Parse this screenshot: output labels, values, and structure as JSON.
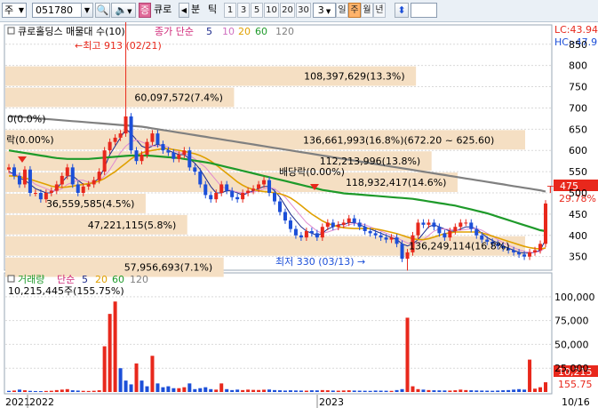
{
  "toolbar": {
    "market": "주",
    "stock_code": "051780",
    "stock_name": "큐로",
    "period_prefix": "분",
    "tick_label": "틱",
    "period_numbers": [
      "1",
      "3",
      "5",
      "10",
      "20",
      "30"
    ],
    "period_custom": "3",
    "period_options": [
      "일",
      "주",
      "월",
      "년"
    ],
    "active_period": "주",
    "badge": "증"
  },
  "colors": {
    "up": "#e8281c",
    "down": "#1c4fd8",
    "ma5": "#1c2a8c",
    "ma10": "#e08bd0",
    "ma20": "#e0a000",
    "ma60": "#1e9a2a",
    "ma120": "#808080",
    "volume_profile": "#f5dfc3"
  },
  "price_panel": {
    "title": "큐로홀딩스 매물대 수(10)",
    "ma_label": "종가 단순",
    "ma_periods": [
      "5",
      "10",
      "20",
      "60",
      "120"
    ],
    "max_annotation": "최고 913 (02/21)",
    "min_annotation": "최저 330 (03/13)",
    "dividend_annotations": [
      "배당락(0.00%)",
      "락(0.00%)"
    ],
    "lc_label": "LC:43.94",
    "hc_label": "HC:-47.9",
    "current_price": "475",
    "pct_label": "29.78%",
    "marker_t": "T",
    "y_ticks": [
      "850",
      "800",
      "750",
      "700",
      "650",
      "600",
      "550",
      "500",
      "450",
      "400",
      "350"
    ]
  },
  "volume_panel": {
    "title": "거래량",
    "ma_label": "단순",
    "ma_periods": [
      "5",
      "20",
      "60",
      "120"
    ],
    "current_volume": "10,215,445주(155.75%)",
    "y_ticks": [
      "100,000",
      "75,000",
      "50,000",
      "25,000"
    ],
    "last_value_label": "10,215",
    "last_pct_label": "155.75"
  },
  "x_axis": {
    "labels": [
      "2021",
      "2022",
      "2023",
      "10/16"
    ]
  },
  "chart_data": [
    {
      "type": "bar",
      "title": "매물대",
      "orientation": "horizontal",
      "price_bands": [
        {
          "low": 800,
          "high": 850,
          "label": "",
          "rel": 0.0
        },
        {
          "low": 750,
          "high": 800,
          "label": "108,397,629(13.3%)",
          "rel": 0.79
        },
        {
          "low": 700,
          "high": 750,
          "label": "60,097,572(7.4%)",
          "rel": 0.44
        },
        {
          "low": 650,
          "high": 700,
          "label": "0(0.0%)",
          "rel": 0.0
        },
        {
          "low": 600,
          "high": 650,
          "label": "136,661,993(16.8%)(672.20 ~ 625.60)",
          "rel": 1.0
        },
        {
          "low": 550,
          "high": 600,
          "label": "112,213,996(13.8%)",
          "rel": 0.82
        },
        {
          "low": 500,
          "high": 550,
          "label": "118,932,417(14.6%)",
          "rel": 0.87
        },
        {
          "low": 450,
          "high": 500,
          "label": "36,559,585(4.5%)",
          "rel": 0.27
        },
        {
          "low": 400,
          "high": 450,
          "label": "47,221,115(5.8%)",
          "rel": 0.35
        },
        {
          "low": 350,
          "high": 400,
          "label": "136,249,114(16.8%)",
          "rel": 1.0
        },
        {
          "low": 300,
          "high": 350,
          "label": "57,956,693(7.1%)",
          "rel": 0.42
        }
      ]
    },
    {
      "type": "line",
      "title": "큐로홀딩스",
      "ylim": [
        320,
        860
      ],
      "series": [
        {
          "name": "종가",
          "values": [
            560,
            540,
            520,
            555,
            500,
            500,
            485,
            500,
            505,
            520,
            540,
            560,
            520,
            500,
            515,
            520,
            530,
            550,
            600,
            620,
            630,
            640,
            680,
            600,
            575,
            590,
            620,
            640,
            615,
            600,
            595,
            580,
            590,
            600,
            560,
            550,
            520,
            495,
            485,
            500,
            520,
            505,
            490,
            485,
            500,
            505,
            510,
            520,
            530,
            500,
            480,
            455,
            435,
            415,
            400,
            395,
            410,
            405,
            395,
            420,
            430,
            420,
            425,
            430,
            440,
            430,
            420,
            410,
            405,
            400,
            395,
            390,
            395,
            380,
            345,
            360,
            400,
            430,
            425,
            430,
            420,
            405,
            395,
            410,
            420,
            430,
            430,
            415,
            400,
            390,
            385,
            380,
            375,
            370,
            365,
            360,
            355,
            350,
            360,
            365,
            380,
            475
          ]
        },
        {
          "name": "5",
          "values": [
            550,
            545,
            535,
            530,
            520,
            510,
            505,
            500,
            500,
            510,
            525,
            540,
            540,
            530,
            520,
            520,
            525,
            535,
            560,
            590,
            610,
            630,
            650,
            640,
            625,
            610,
            605,
            610,
            615,
            610,
            600,
            595,
            590,
            590,
            580,
            570,
            555,
            535,
            515,
            500,
            500,
            505,
            505,
            500,
            495,
            500,
            505,
            510,
            515,
            515,
            505,
            490,
            470,
            450,
            435,
            420,
            410,
            405,
            400,
            405,
            415,
            420,
            425,
            425,
            430,
            430,
            425,
            420,
            415,
            410,
            405,
            400,
            395,
            390,
            380,
            375,
            380,
            390,
            405,
            420,
            425,
            420,
            415,
            410,
            410,
            415,
            420,
            420,
            415,
            405,
            395,
            388,
            382,
            375,
            370,
            365,
            360,
            358,
            358,
            360,
            365,
            390
          ]
        },
        {
          "name": "10",
          "values": [
            545,
            545,
            540,
            535,
            530,
            520,
            515,
            510,
            505,
            505,
            510,
            520,
            525,
            530,
            530,
            525,
            525,
            528,
            540,
            555,
            575,
            595,
            610,
            620,
            625,
            620,
            615,
            610,
            610,
            612,
            608,
            600,
            595,
            592,
            588,
            580,
            570,
            560,
            545,
            530,
            515,
            510,
            505,
            502,
            500,
            500,
            502,
            505,
            510,
            512,
            510,
            500,
            490,
            475,
            460,
            445,
            430,
            420,
            410,
            405,
            408,
            412,
            416,
            420,
            425,
            428,
            428,
            425,
            420,
            415,
            410,
            405,
            400,
            395,
            388,
            382,
            380,
            382,
            390,
            400,
            410,
            415,
            415,
            414,
            412,
            412,
            414,
            416,
            416,
            412,
            405,
            398,
            390,
            383,
            377,
            371,
            366,
            362,
            360,
            360,
            362,
            372
          ]
        },
        {
          "name": "20",
          "values": [
            540,
            540,
            538,
            535,
            532,
            528,
            524,
            520,
            516,
            514,
            513,
            514,
            516,
            518,
            520,
            522,
            524,
            528,
            534,
            542,
            550,
            560,
            570,
            580,
            588,
            594,
            598,
            600,
            602,
            604,
            604,
            602,
            600,
            598,
            595,
            592,
            588,
            582,
            575,
            566,
            556,
            546,
            536,
            526,
            518,
            512,
            508,
            505,
            503,
            502,
            500,
            498,
            494,
            488,
            480,
            470,
            460,
            450,
            442,
            434,
            428,
            424,
            420,
            418,
            417,
            416,
            416,
            416,
            416,
            415,
            413,
            410,
            407,
            404,
            400,
            396,
            392,
            390,
            390,
            392,
            396,
            400,
            404,
            406,
            408,
            408,
            408,
            408,
            408,
            406,
            402,
            398,
            394,
            390,
            386,
            382,
            378,
            374,
            371,
            369,
            368,
            370
          ]
        },
        {
          "name": "60",
          "values": [
            600,
            598,
            596,
            594,
            592,
            590,
            588,
            586,
            584,
            582,
            581,
            580,
            580,
            580,
            580,
            580,
            581,
            582,
            583,
            584,
            585,
            586,
            587,
            588,
            588,
            588,
            588,
            587,
            586,
            585,
            584,
            583,
            582,
            580,
            578,
            576,
            574,
            572,
            570,
            567,
            564,
            561,
            558,
            555,
            552,
            549,
            546,
            543,
            540,
            537,
            534,
            531,
            528,
            525,
            522,
            519,
            516,
            513,
            510,
            507,
            505,
            503,
            501,
            499,
            498,
            497,
            496,
            495,
            494,
            493,
            492,
            491,
            490,
            489,
            488,
            487,
            486,
            484,
            482,
            480,
            478,
            476,
            474,
            472,
            470,
            467,
            464,
            461,
            458,
            455,
            452,
            448,
            444,
            440,
            436,
            432,
            428,
            424,
            420,
            416,
            412,
            410
          ]
        },
        {
          "name": "120",
          "values": [
            680,
            680,
            679,
            678,
            677,
            676,
            675,
            674,
            673,
            672,
            671,
            670,
            669,
            668,
            667,
            666,
            665,
            664,
            663,
            662,
            661,
            660,
            659,
            658,
            657,
            656,
            654,
            652,
            650,
            648,
            646,
            644,
            642,
            640,
            638,
            636,
            634,
            632,
            630,
            628,
            626,
            624,
            622,
            620,
            618,
            616,
            614,
            612,
            610,
            608,
            606,
            604,
            602,
            600,
            598,
            596,
            594,
            592,
            590,
            588,
            586,
            584,
            582,
            580,
            578,
            576,
            574,
            572,
            570,
            568,
            566,
            564,
            562,
            560,
            558,
            556,
            554,
            552,
            550,
            548,
            546,
            544,
            542,
            540,
            538,
            536,
            534,
            532,
            530,
            528,
            526,
            524,
            522,
            520,
            518,
            516,
            514,
            512,
            510,
            508,
            506,
            503
          ]
        }
      ]
    },
    {
      "type": "bar",
      "title": "거래량",
      "ylim": [
        0,
        112000
      ],
      "values": [
        1200,
        1500,
        2500,
        1800,
        1200,
        1000,
        900,
        1100,
        1300,
        2000,
        2500,
        3000,
        1800,
        1500,
        1200,
        1100,
        1300,
        1800,
        48000,
        82000,
        95000,
        25000,
        12000,
        8000,
        30000,
        12000,
        6000,
        38000,
        9000,
        5000,
        6000,
        4000,
        4000,
        5000,
        9000,
        3000,
        4000,
        5000,
        3000,
        2500,
        9000,
        3000,
        2000,
        2500,
        2000,
        2500,
        2200,
        2100,
        2400,
        2600,
        2000,
        1800,
        1500,
        1800,
        1600,
        1500,
        1400,
        1800,
        1700,
        2000,
        1800,
        1500,
        1400,
        1600,
        1800,
        1500,
        1400,
        1300,
        1200,
        1500,
        1400,
        1300,
        1200,
        2000,
        3000,
        78000,
        6000,
        3000,
        2500,
        2000,
        1800,
        1700,
        1600,
        1500,
        1800,
        2500,
        2000,
        1800,
        1600,
        1500,
        1400,
        1300,
        1500,
        1800,
        2000,
        2500,
        3000,
        2500,
        34000,
        3500,
        5000,
        10215
      ],
      "up": [
        0,
        1,
        0,
        1,
        0,
        0,
        0,
        1,
        1,
        1,
        1,
        1,
        0,
        0,
        1,
        1,
        1,
        1,
        1,
        1,
        1,
        0,
        0,
        0,
        1,
        0,
        0,
        1,
        0,
        0,
        0,
        0,
        1,
        1,
        0,
        0,
        0,
        0,
        0,
        1,
        1,
        0,
        0,
        0,
        1,
        1,
        1,
        1,
        1,
        0,
        0,
        0,
        0,
        0,
        0,
        0,
        1,
        0,
        0,
        1,
        1,
        0,
        1,
        1,
        1,
        0,
        0,
        0,
        0,
        0,
        0,
        0,
        1,
        0,
        0,
        1,
        1,
        1,
        0,
        1,
        0,
        0,
        0,
        1,
        1,
        1,
        1,
        0,
        0,
        0,
        0,
        0,
        0,
        0,
        0,
        0,
        0,
        0,
        1,
        1,
        1,
        1
      ]
    }
  ]
}
